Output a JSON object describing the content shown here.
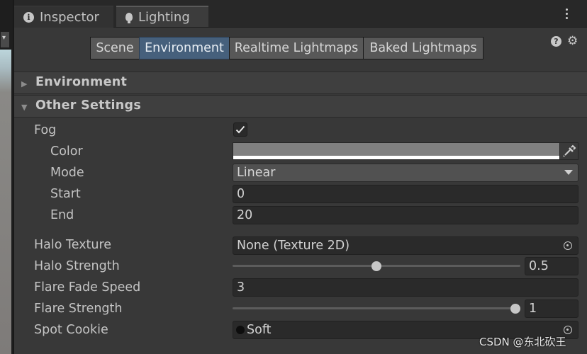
{
  "tabs": [
    {
      "label": "Inspector",
      "icon": "info-icon"
    },
    {
      "label": "Lighting",
      "icon": "light-bulb-icon"
    }
  ],
  "toolbar": {
    "segments": [
      "Scene",
      "Environment",
      "Realtime Lightmaps",
      "Baked Lightmaps"
    ],
    "active": "Environment",
    "help_glyph": "?"
  },
  "sections": {
    "environment": "Environment",
    "other": "Other Settings"
  },
  "fog": {
    "label": "Fog",
    "enabled": true,
    "color_label": "Color",
    "mode_label": "Mode",
    "mode_value": "Linear",
    "start_label": "Start",
    "start_value": "0",
    "end_label": "End",
    "end_value": "20"
  },
  "halo": {
    "texture_label": "Halo Texture",
    "texture_value": "None (Texture 2D)",
    "strength_label": "Halo Strength",
    "strength_value": "0.5"
  },
  "flare": {
    "fade_label": "Flare Fade Speed",
    "fade_value": "3",
    "strength_label": "Flare Strength",
    "strength_value": "1"
  },
  "spot_cookie": {
    "label": "Spot Cookie",
    "value": "Soft"
  },
  "watermark": "CSDN @东北砍王",
  "colors": {
    "active_segment": "#46607c",
    "panel_bg": "#383838",
    "fog_color_preview": "#808080"
  }
}
